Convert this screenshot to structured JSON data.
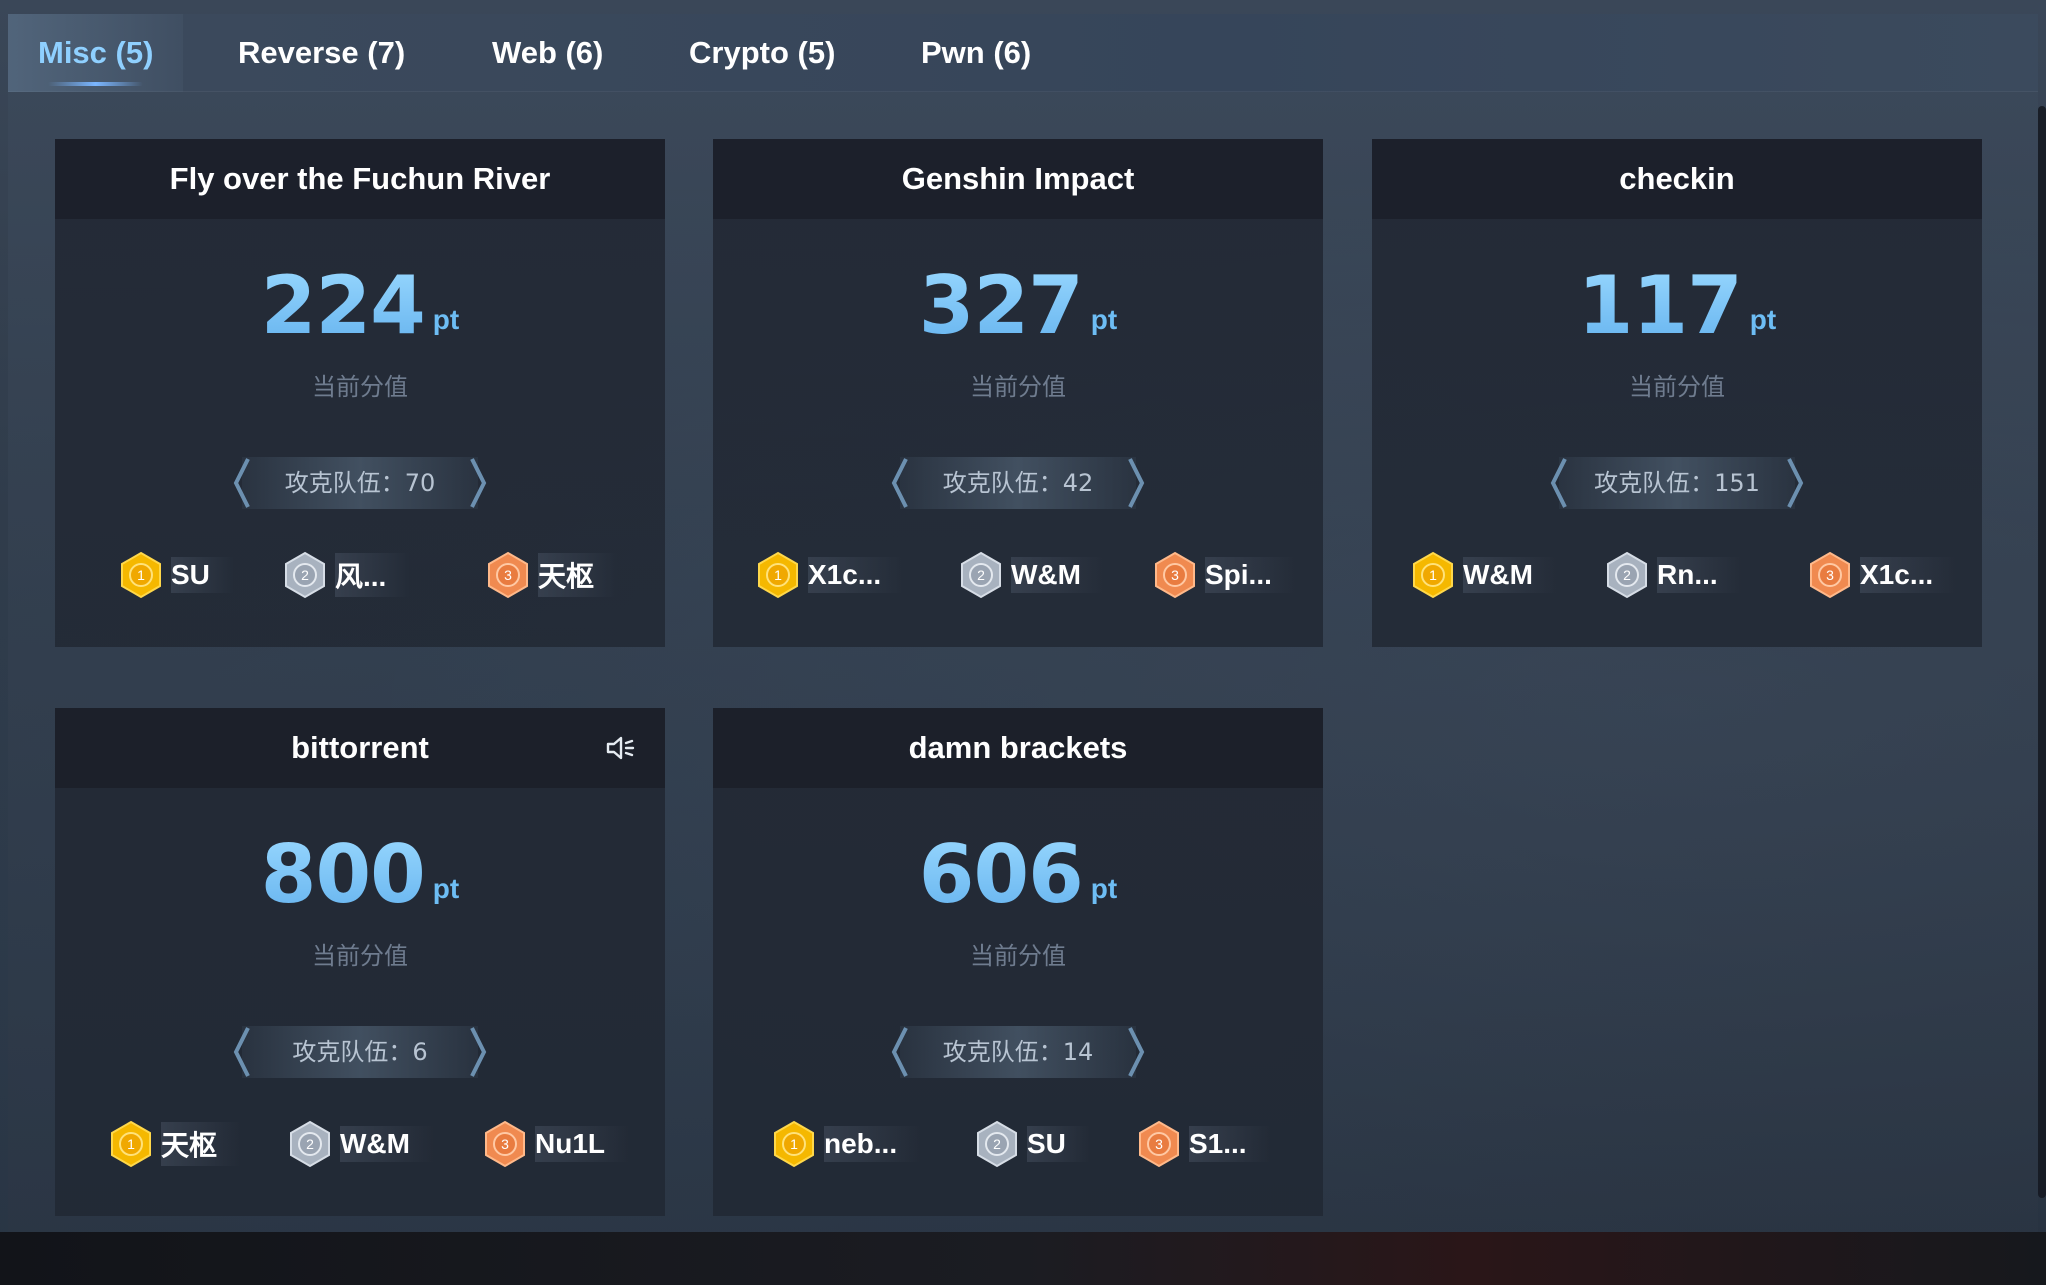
{
  "tabs": [
    {
      "label": "Misc (5)",
      "active": true
    },
    {
      "label": "Reverse (7)",
      "active": false
    },
    {
      "label": "Web (6)",
      "active": false
    },
    {
      "label": "Crypto (5)",
      "active": false
    },
    {
      "label": "Pwn (6)",
      "active": false
    }
  ],
  "colors": {
    "accent": "#8fd0ff",
    "score": "#7cc8f8",
    "gold": "#f5b800",
    "silver": "#a8b2bf",
    "bronze": "#f08a50"
  },
  "score_label": "当前分值",
  "score_unit": "pt",
  "cards": [
    {
      "title": "Fly over the Fuchun River",
      "score": "224",
      "solves": "攻克队伍：70",
      "top": [
        {
          "rank": "1",
          "team": "SU"
        },
        {
          "rank": "2",
          "team": "风..."
        },
        {
          "rank": "3",
          "team": "天枢"
        }
      ]
    },
    {
      "title": "Genshin Impact",
      "score": "327",
      "solves": "攻克队伍：42",
      "top": [
        {
          "rank": "1",
          "team": "X1c..."
        },
        {
          "rank": "2",
          "team": "W&M"
        },
        {
          "rank": "3",
          "team": "Spi..."
        }
      ]
    },
    {
      "title": "checkin",
      "score": "117",
      "solves": "攻克队伍：151",
      "top": [
        {
          "rank": "1",
          "team": "W&M"
        },
        {
          "rank": "2",
          "team": "Rn..."
        },
        {
          "rank": "3",
          "team": "X1c..."
        }
      ]
    },
    {
      "title": "bittorrent",
      "score": "800",
      "solves": "攻克队伍：6",
      "has_audio": true,
      "top": [
        {
          "rank": "1",
          "team": "天枢"
        },
        {
          "rank": "2",
          "team": "W&M"
        },
        {
          "rank": "3",
          "team": "Nu1L"
        }
      ]
    },
    {
      "title": "damn brackets",
      "score": "606",
      "solves": "攻克队伍：14",
      "top": [
        {
          "rank": "1",
          "team": "neb..."
        },
        {
          "rank": "2",
          "team": "SU"
        },
        {
          "rank": "3",
          "team": "S1..."
        }
      ]
    }
  ]
}
